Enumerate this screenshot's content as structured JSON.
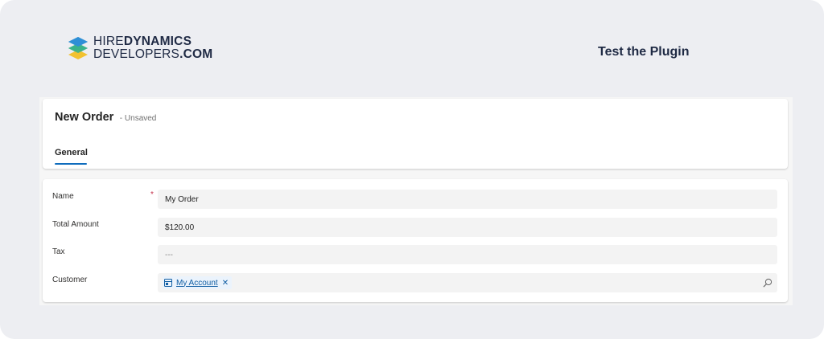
{
  "brand": {
    "line1_thin": "HIRE",
    "line1_bold": "DYNAMICS",
    "line2_thin": "DEVELOPERS",
    "line2_bold": ".COM",
    "logo_colors": [
      "#2e8fd6",
      "#3bb28a",
      "#f2c230"
    ]
  },
  "heading": "Test the Plugin",
  "record": {
    "title": "New Order",
    "state": "- Unsaved"
  },
  "tabs": [
    {
      "label": "General",
      "selected": true
    }
  ],
  "form": {
    "name": {
      "label": "Name",
      "required_mark": "*",
      "value": "My Order"
    },
    "total_amount": {
      "label": "Total Amount",
      "value": "$120.00"
    },
    "tax": {
      "label": "Tax",
      "value": "---"
    },
    "customer": {
      "label": "Customer",
      "value": "My Account",
      "remove_glyph": "✕"
    }
  },
  "colors": {
    "accent": "#0f6cbd",
    "link": "#115ea3",
    "required": "#c4314b",
    "background": "#edeef2"
  }
}
